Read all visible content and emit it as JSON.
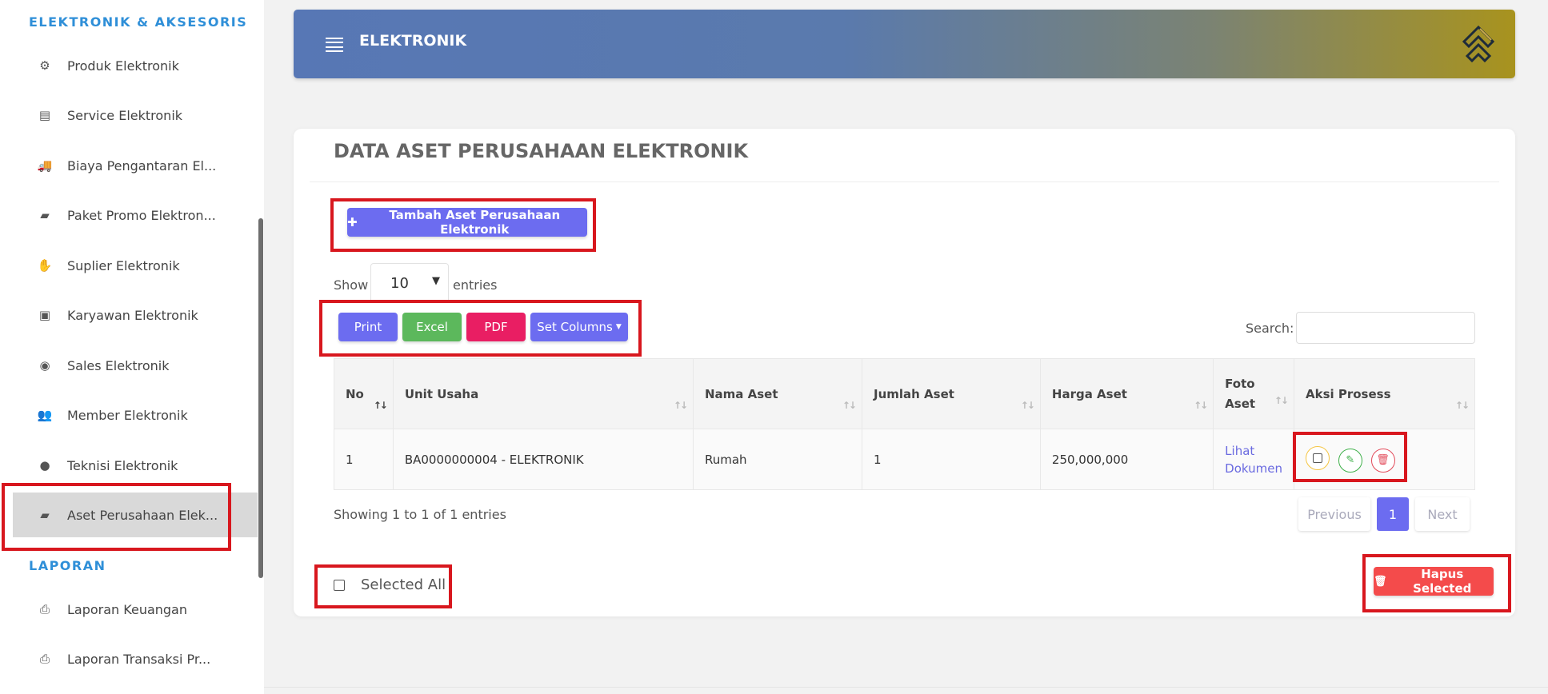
{
  "sidebar": {
    "section_elektronik": "ELEKTRONIK & AKSESORIS",
    "section_laporan": "LAPORAN",
    "items": [
      {
        "label": "Produk Elektronik",
        "icon": "⚙"
      },
      {
        "label": "Service Elektronik",
        "icon": "▤"
      },
      {
        "label": "Biaya Pengantaran El...",
        "icon": "🚚"
      },
      {
        "label": "Paket Promo Elektron...",
        "icon": "▰"
      },
      {
        "label": "Suplier Elektronik",
        "icon": "✋"
      },
      {
        "label": "Karyawan Elektronik",
        "icon": "▣"
      },
      {
        "label": "Sales Elektronik",
        "icon": "◉"
      },
      {
        "label": "Member Elektronik",
        "icon": "👥"
      },
      {
        "label": "Teknisi Elektronik",
        "icon": "●"
      },
      {
        "label": "Aset Perusahaan Elek...",
        "icon": "▰"
      }
    ],
    "report_items": [
      {
        "label": "Laporan Keuangan",
        "icon": "⎙"
      },
      {
        "label": "Laporan Transaksi Pr...",
        "icon": "⎙"
      }
    ]
  },
  "header": {
    "title": "ELEKTRONIK"
  },
  "card": {
    "title": "DATA ASET PERUSAHAAN ELEKTRONIK",
    "add_button": "Tambah Aset Perusahaan Elektronik",
    "show_label": "Show",
    "entries_value": "10",
    "entries_label": "entries",
    "export": {
      "print": "Print",
      "excel": "Excel",
      "pdf": "PDF",
      "set_columns": "Set Columns"
    },
    "search_label": "Search:",
    "search_value": ""
  },
  "table": {
    "headers": {
      "no": "No",
      "unit_usaha": "Unit Usaha",
      "nama_aset": "Nama Aset",
      "jumlah_aset": "Jumlah Aset",
      "harga_aset": "Harga Aset",
      "foto_aset_1": "Foto",
      "foto_aset_2": "Aset",
      "aksi": "Aksi Prosess"
    },
    "rows": [
      {
        "no": "1",
        "unit_usaha": "BA0000000004 - ELEKTRONIK",
        "nama_aset": "Rumah",
        "jumlah_aset": "1",
        "harga_aset": "250,000,000",
        "foto_1": "Lihat",
        "foto_2": "Dokumen"
      }
    ]
  },
  "footer": {
    "info": "Showing 1 to 1 of 1 entries",
    "previous": "Previous",
    "page": "1",
    "next": "Next",
    "select_all": "Selected All",
    "delete_selected": "Hapus Selected"
  },
  "colors": {
    "accent": "#6c6cf0",
    "success": "#5cb85c",
    "pdf": "#e91e63",
    "danger": "#f44b4b",
    "highlight": "#d8171e"
  }
}
